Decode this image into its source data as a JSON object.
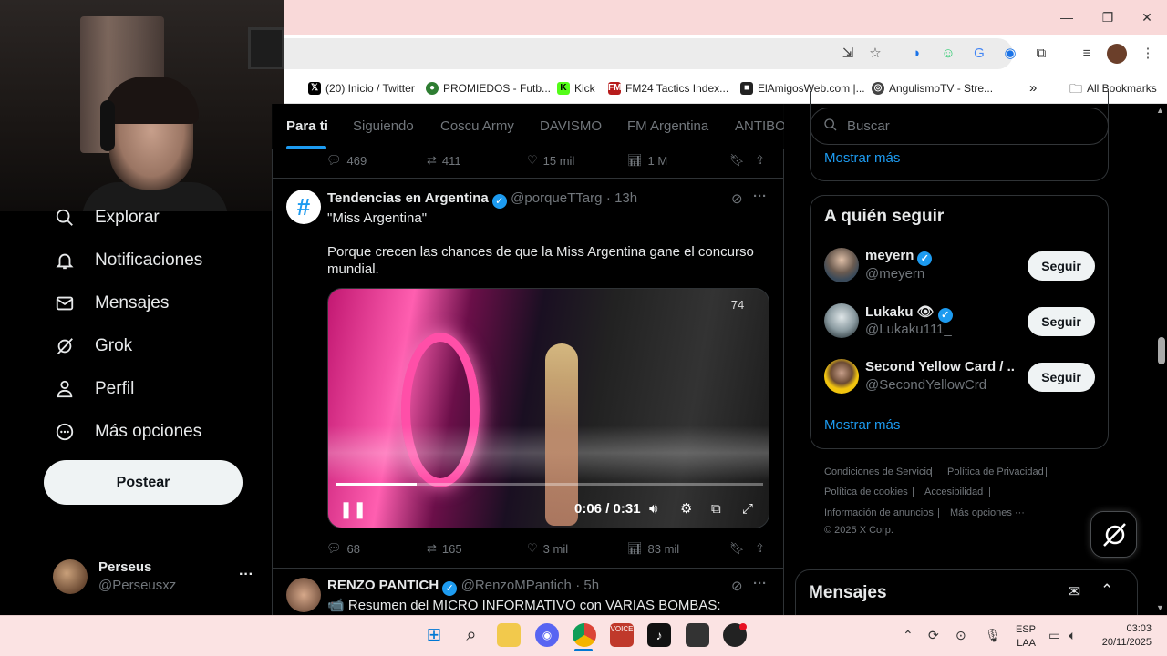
{
  "browser": {
    "window_controls": {
      "minimize": "—",
      "maximize": "❐",
      "close": "✕"
    },
    "bookmarks": [
      {
        "label": "(20) Inicio / Twitter",
        "icon": "x-logo-icon",
        "color": "#000000"
      },
      {
        "label": "PROMIEDOS - Futb...",
        "icon": "promiedos-icon",
        "color": "#2e7d32"
      },
      {
        "label": "Kick",
        "icon": "kick-icon",
        "color": "#53fc18"
      },
      {
        "label": "FM24 Tactics Index...",
        "icon": "fm-icon",
        "color": "#b71c1c"
      },
      {
        "label": "ElAmigosWeb.com |...",
        "icon": "elamigos-icon",
        "color": "#222222"
      },
      {
        "label": "AngulismoTV - Stre...",
        "icon": "angulismo-icon",
        "color": "#444444"
      }
    ],
    "all_bookmarks": "All Bookmarks",
    "overflow": "»"
  },
  "sidebar": {
    "items": [
      {
        "label": "Explorar",
        "icon": "search-icon"
      },
      {
        "label": "Notificaciones",
        "icon": "bell-icon"
      },
      {
        "label": "Mensajes",
        "icon": "mail-icon"
      },
      {
        "label": "Grok",
        "icon": "grok-icon"
      },
      {
        "label": "Perfil",
        "icon": "person-icon"
      },
      {
        "label": "Más opciones",
        "icon": "more-circle-icon"
      }
    ],
    "post_button": "Postear",
    "account": {
      "name": "Perseus",
      "handle": "@Perseusxz",
      "menu": "···"
    }
  },
  "feed": {
    "tabs": [
      "Para ti",
      "Siguiendo",
      "Coscu Army",
      "DAVISMO",
      "FM Argentina",
      "ANTIBO"
    ],
    "active_tab": "Para ti",
    "prev_tweet_actions": {
      "replies": "469",
      "reposts": "411",
      "likes": "15 mil",
      "views": "1 M"
    },
    "tweet": {
      "name": "Tendencias en Argentina",
      "handle": "@porqueTTarg",
      "time": "· 13h",
      "title": "\"Miss Argentina\"",
      "text": "Porque crecen las chances de que la Miss Argentina gane el concurso mundial.",
      "video": {
        "time": "0:06 / 0:31",
        "progress": 0.19,
        "logo": "74"
      },
      "actions": {
        "replies": "68",
        "reposts": "165",
        "likes": "3 mil",
        "views": "83 mil"
      }
    },
    "next_tweet": {
      "name": "RENZO PANTICH",
      "handle": "@RenzoMPantich",
      "time": "· 5h",
      "text": "Resumen del MICRO INFORMATIVO con VARIAS BOMBAS:"
    }
  },
  "right": {
    "search_placeholder": "Buscar",
    "show_more": "Mostrar más",
    "who_to_follow": {
      "title": "A quién seguir",
      "users": [
        {
          "name": "meyern",
          "handle": "@meyern",
          "button": "Seguir",
          "avatar_color": "#3a4a5a"
        },
        {
          "name": "Lukaku 👁",
          "handle": "@Lukaku111_",
          "button": "Seguir",
          "avatar_color": "#6f7f86"
        },
        {
          "name": "Second Yellow Card / ...",
          "handle": "@SecondYellowCrd",
          "button": "Seguir",
          "avatar_color": "#f1c40f"
        }
      ],
      "show_more": "Mostrar más"
    },
    "footer": [
      "Condiciones de Servicio",
      "Política de Privacidad",
      "Política de cookies",
      "Accesibilidad",
      "Información de anuncios",
      "Más opciones ···",
      "© 2025 X Corp."
    ],
    "messages": "Mensajes"
  },
  "taskbar": {
    "lang": "ESP",
    "lang2": "LAA",
    "time": "03:03",
    "date": "20/11/2025"
  }
}
